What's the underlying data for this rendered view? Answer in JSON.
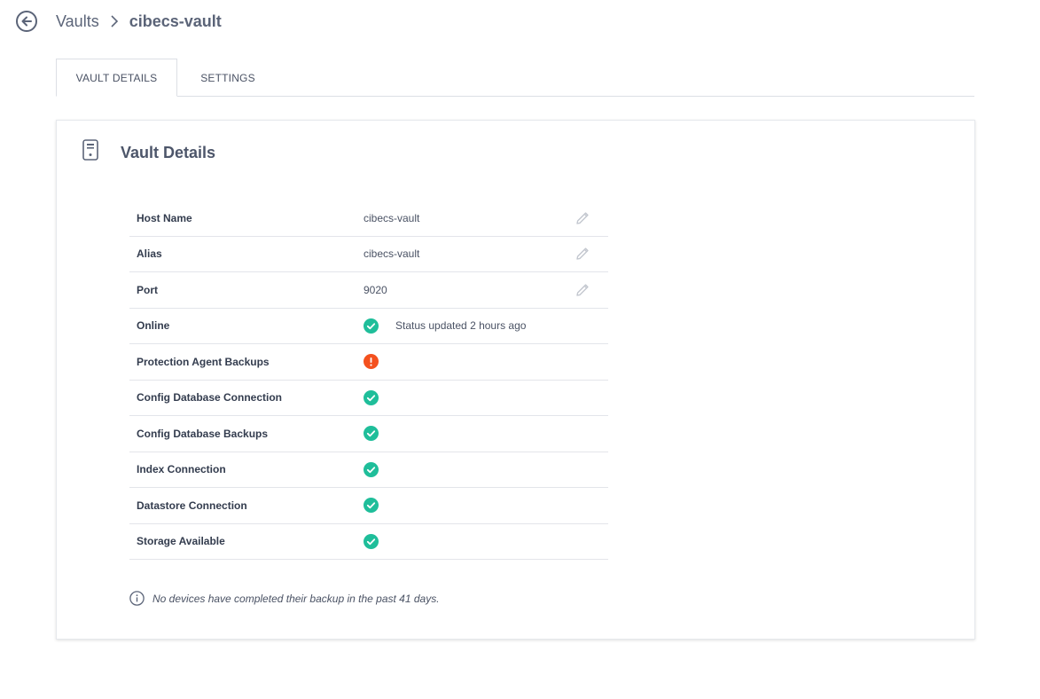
{
  "header": {
    "breadcrumb_root": "Vaults",
    "breadcrumb_current": "cibecs-vault"
  },
  "tabs": [
    {
      "label": "VAULT DETAILS",
      "active": true
    },
    {
      "label": "SETTINGS",
      "active": false
    }
  ],
  "card": {
    "title": "Vault Details",
    "rows": [
      {
        "label": "Host Name",
        "value": "cibecs-vault",
        "editable": true
      },
      {
        "label": "Alias",
        "value": "cibecs-vault",
        "editable": true
      },
      {
        "label": "Port",
        "value": "9020",
        "editable": true
      },
      {
        "label": "Online",
        "status": "ok",
        "status_text": "Status updated 2 hours ago"
      },
      {
        "label": "Protection Agent Backups",
        "status": "error"
      },
      {
        "label": "Config Database Connection",
        "status": "ok"
      },
      {
        "label": "Config Database Backups",
        "status": "ok"
      },
      {
        "label": "Index Connection",
        "status": "ok"
      },
      {
        "label": "Datastore Connection",
        "status": "ok"
      },
      {
        "label": "Storage Available",
        "status": "ok"
      }
    ],
    "note": "No devices have completed their backup in the past 41 days."
  },
  "colors": {
    "ok": "#1fbe9a",
    "error": "#f4511e",
    "text": "#333c4e",
    "muted": "#5b6478"
  },
  "icons": {
    "back": "arrow-left-circle-icon",
    "breadcrumb_separator": "chevron-right-icon",
    "card": "server-icon",
    "edit": "pencil-icon",
    "ok": "check-circle-icon",
    "error": "exclamation-circle-icon",
    "info": "info-circle-icon"
  }
}
